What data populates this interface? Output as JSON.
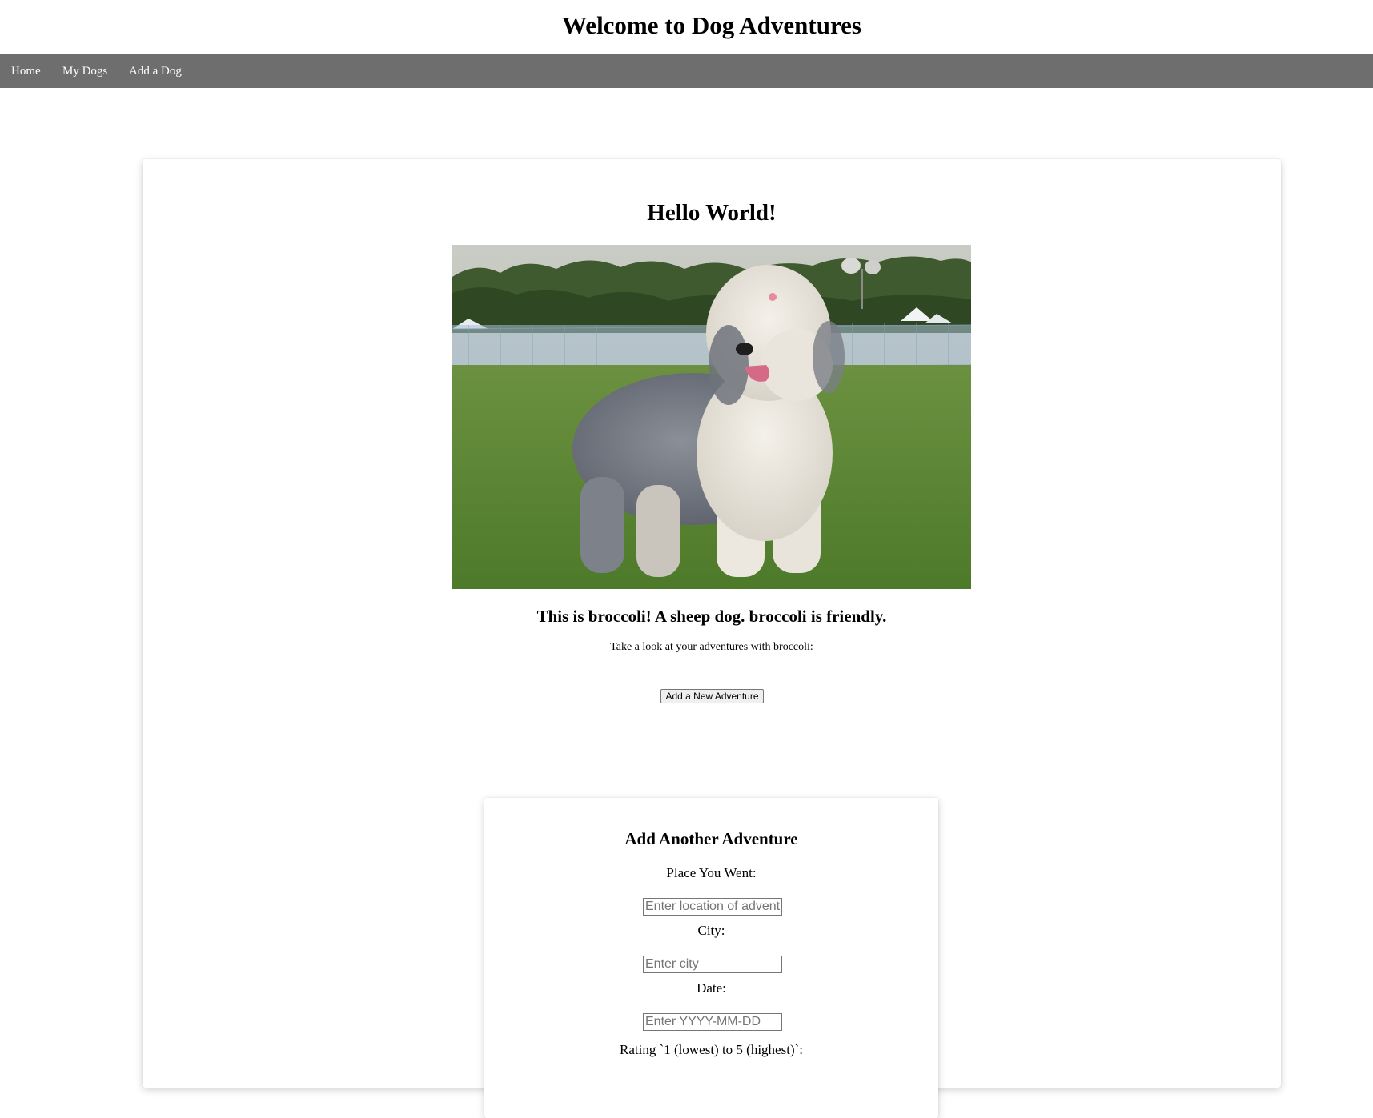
{
  "header": {
    "title": "Welcome to Dog Adventures"
  },
  "nav": {
    "items": [
      {
        "label": "Home"
      },
      {
        "label": "My Dogs"
      },
      {
        "label": "Add a Dog"
      }
    ]
  },
  "main": {
    "title": "Hello World!",
    "dog_image_icon": "sheepdog-photo",
    "dog_description": "This is broccoli! A sheep dog. broccoli is friendly.",
    "adventures_intro": "Take a look at your adventures with broccoli:",
    "add_adventure_button": "Add a New Adventure"
  },
  "form": {
    "title": "Add Another Adventure",
    "place_label": "Place You Went:",
    "place_placeholder": "Enter location of adventure",
    "city_label": "City:",
    "city_placeholder": "Enter city",
    "date_label": "Date:",
    "date_placeholder": "Enter YYYY-MM-DD",
    "rating_label": "Rating `1 (lowest) to 5 (highest)`:"
  }
}
